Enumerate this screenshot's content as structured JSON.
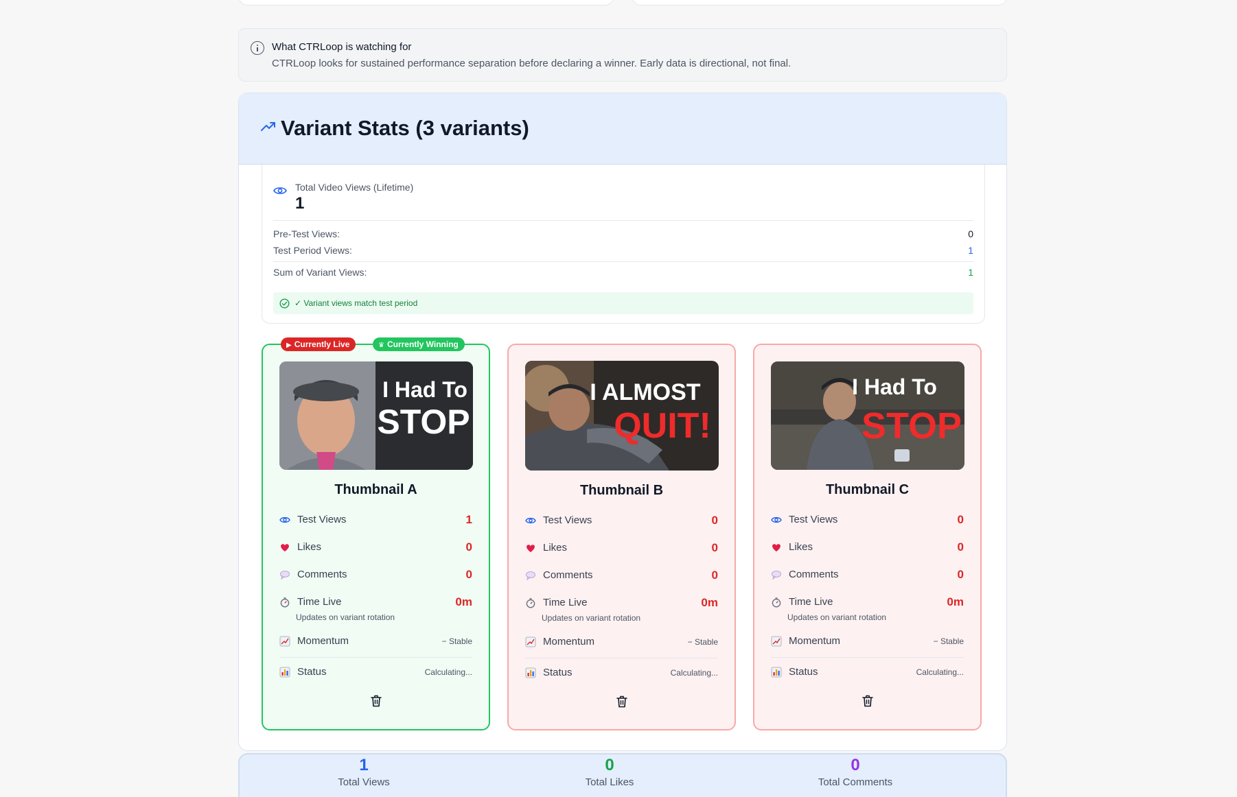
{
  "info": {
    "title": "What CTRLoop is watching for",
    "text": "CTRLoop looks for sustained performance separation before declaring a winner. Early data is directional, not final."
  },
  "stats": {
    "title": "Variant Stats (3 variants)",
    "total_views_label": "Total Video Views (Lifetime)",
    "total_views_value": "1",
    "pretest_label": "Pre-Test Views:",
    "pretest_value": "0",
    "test_period_label": "Test Period Views:",
    "test_period_value": "1",
    "sum_label": "Sum of Variant Views:",
    "sum_value": "1",
    "match_text": "✓ Variant views match test period"
  },
  "badges": {
    "live": "Currently Live",
    "winning": "Currently Winning"
  },
  "stat_labels": {
    "test_views": "Test Views",
    "likes": "Likes",
    "comments": "Comments",
    "time_live": "Time Live",
    "time_note": "Updates on variant rotation",
    "momentum": "Momentum",
    "status": "Status"
  },
  "variants": [
    {
      "name": "Thumbnail A",
      "thumb_line1": "I Had To",
      "thumb_line2": "STOP",
      "test_views": "1",
      "likes": "0",
      "comments": "0",
      "time_live": "0m",
      "momentum": "− Stable",
      "status": "Calculating..."
    },
    {
      "name": "Thumbnail B",
      "thumb_line1": "I ALMOST",
      "thumb_line2": "QUIT!",
      "test_views": "0",
      "likes": "0",
      "comments": "0",
      "time_live": "0m",
      "momentum": "− Stable",
      "status": "Calculating..."
    },
    {
      "name": "Thumbnail C",
      "thumb_line1": "I Had To",
      "thumb_line2": "STOP",
      "test_views": "0",
      "likes": "0",
      "comments": "0",
      "time_live": "0m",
      "momentum": "− Stable",
      "status": "Calculating..."
    }
  ],
  "totals": [
    {
      "value": "1",
      "label": "Total Views",
      "color": "#2563eb"
    },
    {
      "value": "0",
      "label": "Total Likes",
      "color": "#16a34a"
    },
    {
      "value": "0",
      "label": "Total Comments",
      "color": "#9333ea"
    }
  ],
  "colors": {
    "accent_blue": "#2563eb",
    "winning_green": "#22c55e",
    "live_red": "#dc2626",
    "value_red": "#dc2626",
    "match_green": "#15803d",
    "comments_purple": "#9333ea"
  }
}
